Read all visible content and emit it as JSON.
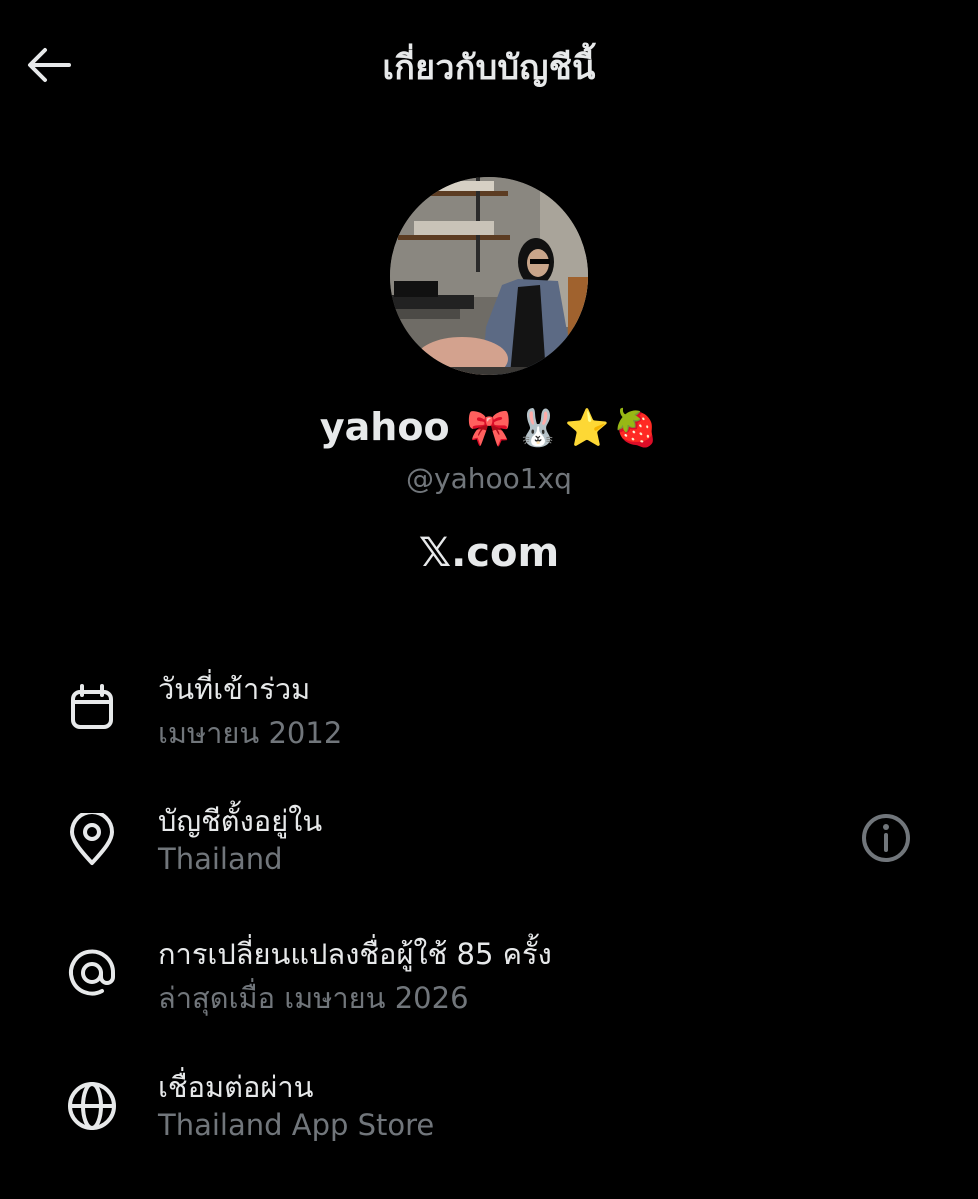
{
  "header": {
    "title": "เกี่ยวกับบัญชีนี้",
    "back_icon": "arrow-left-icon"
  },
  "profile": {
    "display_name": "yahoo",
    "emojis": [
      "🎀",
      "🐰",
      "⭐",
      "🍓"
    ],
    "handle": "@yahoo1xq",
    "site": "𝕏.com"
  },
  "details": [
    {
      "icon": "calendar-icon",
      "title": "วันที่เข้าร่วม",
      "value": "เมษายน 2012"
    },
    {
      "icon": "location-pin-icon",
      "title": "บัญชีตั้งอยู่ใน",
      "value": "Thailand",
      "info_icon": "info-icon"
    },
    {
      "icon": "at-sign-icon",
      "title": "การเปลี่ยนแปลงชื่อผู้ใช้ 85 ครั้ง",
      "value": "ล่าสุดเมื่อ เมษายน 2026"
    },
    {
      "icon": "globe-icon",
      "title": "เชื่อมต่อผ่าน",
      "value": "Thailand App Store"
    }
  ],
  "colors": {
    "background": "#000000",
    "primary_text": "#e7e9ea",
    "secondary_text": "#71767b"
  }
}
